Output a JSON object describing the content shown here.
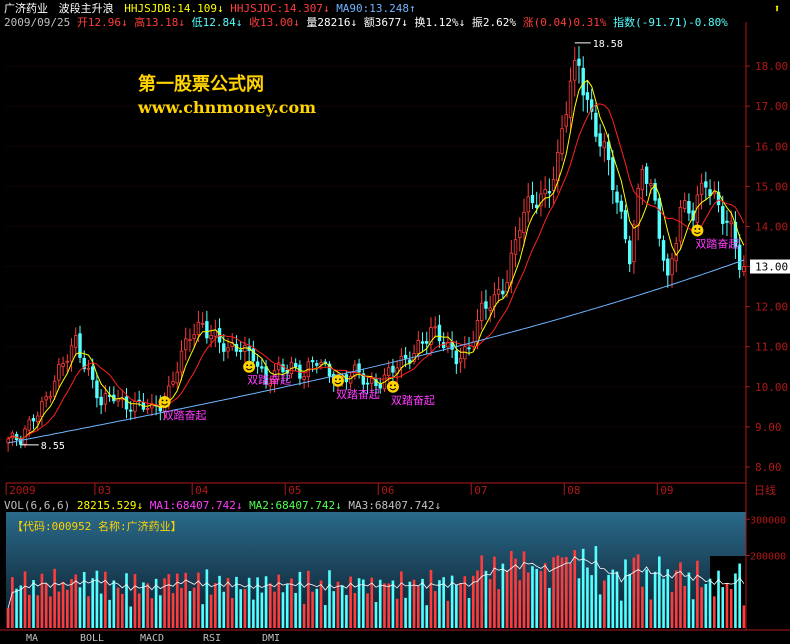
{
  "header": {
    "stock_name": "广济药业",
    "indicator_name": "波段主升浪",
    "hhjsjdb": "HHJSJDB:14.109",
    "hhjsjdc": "HHJSJDC:14.307",
    "ma90": "MA90:13.248",
    "date": "2009/09/25",
    "open": "开12.96",
    "high": "高13.18",
    "low": "低12.84",
    "close": "收13.00",
    "volume": "量28216",
    "amount": "额3677",
    "turnover": "换1.12%",
    "amplitude": "振2.62%",
    "change": "涨(0.04)0.31%",
    "index": "指数(-91.71)-0.80%",
    "corner_icon": "arrow-up-icon"
  },
  "watermark": {
    "line1": "第一股票公式网",
    "line2": "www.chnmoney.com"
  },
  "volume_header": {
    "vol": "VOL(6,6,6)",
    "vol_value": "28215.529",
    "ma1": "MA1:68407.742",
    "ma2": "MA2:68407.742",
    "ma3": "MA3:68407.742"
  },
  "code_label": "【代码:000952 名称:广济药业】",
  "bottom_tabs": [
    "MA",
    "BOLL",
    "MACD",
    "RSI",
    "DMI"
  ],
  "colors": {
    "up": "#ff3c3c",
    "down": "#54ffff",
    "ma_yellow": "#ffff00",
    "ma_red": "#ff2020",
    "ma90": "#6fb4ff",
    "signal": "#ff3cff",
    "smile": "#ffd400",
    "axis": "#b01818",
    "price_tag": "#ffffff"
  },
  "chart_data": {
    "type": "candlestick",
    "y_ticks": [
      8.0,
      9.0,
      10.0,
      11.0,
      12.0,
      13.0,
      14.0,
      15.0,
      16.0,
      17.0,
      18.0
    ],
    "y_labels": [
      "8.00",
      "9.00",
      "10.00",
      "11.00",
      "12.00",
      "13.00",
      "14.00",
      "15.00",
      "16.00",
      "17.00",
      "18.00"
    ],
    "ylim": [
      7.6,
      18.9
    ],
    "x_labels": [
      "2009",
      "03",
      "04",
      "05",
      "06",
      "07",
      "08",
      "09"
    ],
    "x_label_index": [
      0,
      21,
      44,
      66,
      88,
      110,
      132,
      154
    ],
    "period_label": "日线",
    "low_marker": {
      "text": "8.55",
      "index": 3,
      "value": 8.55
    },
    "high_marker": {
      "text": "18.58",
      "index": 134,
      "value": 18.58
    },
    "last_price_tag": "13.00",
    "last_price": 13.0,
    "signal_label": "双踏奋起",
    "signals": [
      {
        "index": 37,
        "value": 9.62
      },
      {
        "index": 57,
        "value": 10.5
      },
      {
        "index": 78,
        "value": 10.15
      },
      {
        "index": 91,
        "value": 10.0
      },
      {
        "index": 163,
        "value": 13.9
      }
    ],
    "key_prices": [
      [
        0,
        8.7
      ],
      [
        3,
        8.6
      ],
      [
        6,
        9.3
      ],
      [
        10,
        9.9
      ],
      [
        13,
        10.5
      ],
      [
        16,
        11.2
      ],
      [
        19,
        10.4
      ],
      [
        22,
        9.5
      ],
      [
        25,
        9.8
      ],
      [
        28,
        9.6
      ],
      [
        31,
        9.5
      ],
      [
        34,
        9.4
      ],
      [
        37,
        9.7
      ],
      [
        40,
        10.5
      ],
      [
        43,
        11.2
      ],
      [
        46,
        11.6
      ],
      [
        49,
        11.3
      ],
      [
        52,
        10.8
      ],
      [
        55,
        11.0
      ],
      [
        58,
        10.9
      ],
      [
        61,
        10.0
      ],
      [
        64,
        10.4
      ],
      [
        67,
        10.6
      ],
      [
        70,
        10.3
      ],
      [
        73,
        10.6
      ],
      [
        76,
        10.4
      ],
      [
        79,
        10.2
      ],
      [
        82,
        10.3
      ],
      [
        85,
        10.1
      ],
      [
        88,
        10.2
      ],
      [
        91,
        10.4
      ],
      [
        94,
        10.6
      ],
      [
        97,
        11.1
      ],
      [
        100,
        11.4
      ],
      [
        103,
        11.0
      ],
      [
        106,
        10.8
      ],
      [
        109,
        11.0
      ],
      [
        112,
        11.8
      ],
      [
        115,
        12.2
      ],
      [
        118,
        12.8
      ],
      [
        121,
        14.0
      ],
      [
        124,
        14.6
      ],
      [
        127,
        14.9
      ],
      [
        130,
        15.6
      ],
      [
        133,
        17.5
      ],
      [
        135,
        18.1
      ],
      [
        138,
        16.8
      ],
      [
        141,
        15.8
      ],
      [
        144,
        14.6
      ],
      [
        147,
        13.4
      ],
      [
        150,
        15.5
      ],
      [
        153,
        14.4
      ],
      [
        156,
        12.7
      ],
      [
        159,
        14.5
      ],
      [
        162,
        14.2
      ],
      [
        165,
        15.2
      ],
      [
        168,
        14.6
      ],
      [
        171,
        13.8
      ],
      [
        173,
        13.0
      ]
    ],
    "volume_y_labels": [
      "300000",
      "200000"
    ],
    "volume_y_ticks": [
      300000,
      200000
    ],
    "volume_ylim": [
      0,
      320000
    ]
  }
}
